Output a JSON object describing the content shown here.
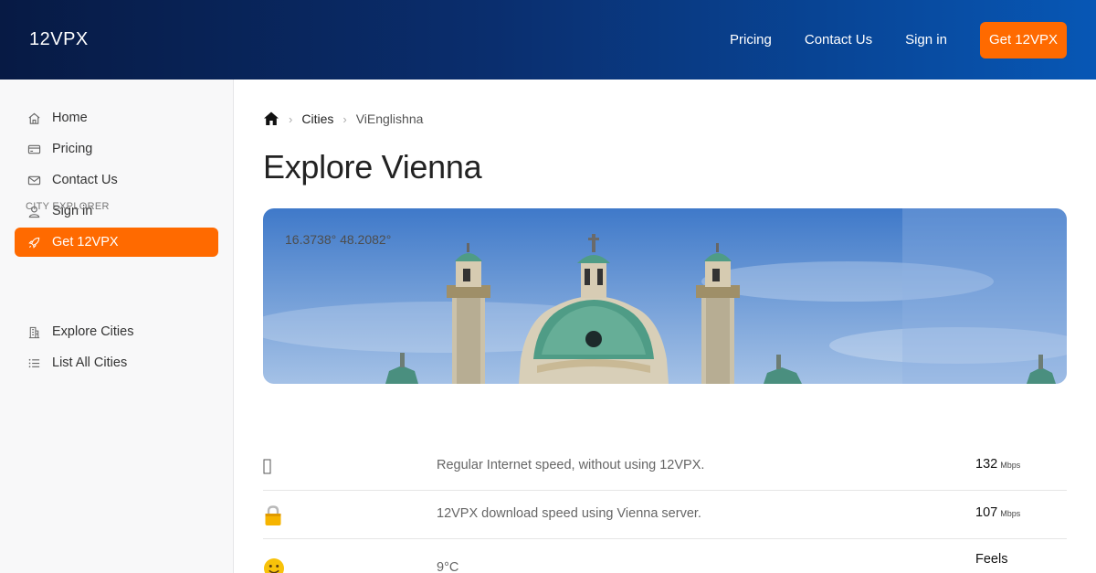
{
  "header": {
    "brand": "12VPX",
    "nav": [
      "Pricing",
      "Contact Us",
      "Sign in"
    ],
    "cta": "Get 12VPX",
    "accent": "#ff6a00"
  },
  "sidebar": {
    "items": [
      {
        "label": "Home",
        "icon": "home-icon"
      },
      {
        "label": "Pricing",
        "icon": "credit-card-icon"
      },
      {
        "label": "Contact Us",
        "icon": "mail-icon"
      },
      {
        "label": "Sign in",
        "icon": "user-icon"
      },
      {
        "label": "Get 12VPX",
        "icon": "rocket-icon",
        "active": true
      }
    ],
    "section_title": "CITY EXPLORER",
    "section_items": [
      {
        "label": "Explore Cities",
        "icon": "buildings-icon"
      },
      {
        "label": "List All Cities",
        "icon": "list-icon"
      }
    ]
  },
  "breadcrumb": {
    "home_icon": "home-icon",
    "items": [
      "Cities",
      "ViEnglishna"
    ]
  },
  "page": {
    "title": "Explore Vienna",
    "coordinates": "16.3738° 48.2082°"
  },
  "rows": [
    {
      "icon": "unknown-glyph",
      "description": "Regular Internet speed, without using 12VPX.",
      "value": "132",
      "unit": "Mbps"
    },
    {
      "icon": "lock-emoji",
      "description": "12VPX download speed using Vienna server.",
      "value": "107",
      "unit": "Mbps"
    },
    {
      "icon": "smile-emoji",
      "description": "9°C",
      "value": "Feels",
      "unit": ""
    }
  ]
}
